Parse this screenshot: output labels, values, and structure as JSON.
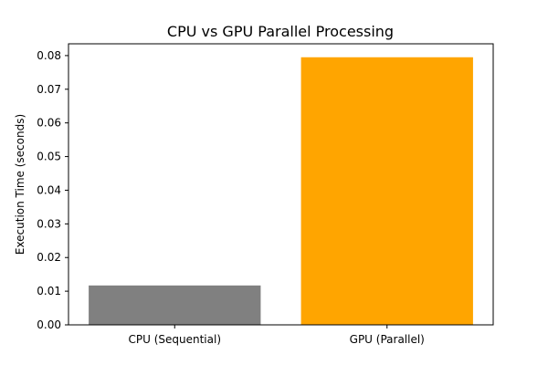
{
  "chart_data": {
    "type": "bar",
    "title": "CPU vs GPU Parallel Processing",
    "xlabel": "",
    "ylabel": "Execution Time (seconds)",
    "categories": [
      "CPU (Sequential)",
      "GPU (Parallel)"
    ],
    "values": [
      0.0117,
      0.0795
    ],
    "colors": [
      "#808080",
      "#ffa500"
    ],
    "ylim": [
      0,
      0.0835
    ],
    "yticks": [
      0.0,
      0.01,
      0.02,
      0.03,
      0.04,
      0.05,
      0.06,
      0.07,
      0.08
    ],
    "ytick_labels": [
      "0.00",
      "0.01",
      "0.02",
      "0.03",
      "0.04",
      "0.05",
      "0.06",
      "0.07",
      "0.08"
    ],
    "grid": false,
    "legend": "none"
  }
}
